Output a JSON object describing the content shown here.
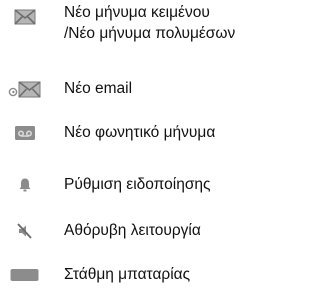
{
  "indicators": [
    {
      "icon": "envelope-icon",
      "label_lines": [
        "Νέο μήνυμα κειμένου",
        "/Νέο μήνυμα πολυμέσων"
      ]
    },
    {
      "icon": "email-envelope-icon",
      "label_lines": [
        "Νέο email"
      ]
    },
    {
      "icon": "voicemail-icon",
      "label_lines": [
        "Νέο φωνητικό μήνυμα"
      ]
    },
    {
      "icon": "bell-icon",
      "label_lines": [
        "Ρύθμιση ειδοποίησης"
      ]
    },
    {
      "icon": "silent-mode-icon",
      "label_lines": [
        "Αθόρυβη λειτουργία"
      ]
    },
    {
      "icon": "battery-icon",
      "label_lines": [
        "Στάθμη μπαταρίας"
      ]
    }
  ],
  "colors": {
    "icon_gray": "#8c8c8c",
    "icon_dark": "#6e6e6e",
    "text": "#111111"
  }
}
